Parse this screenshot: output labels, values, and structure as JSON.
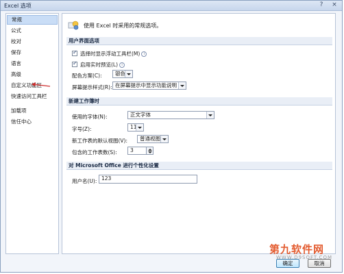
{
  "window": {
    "title": "Excel 选项",
    "help": "?",
    "close": "×"
  },
  "sidebar": {
    "items": [
      {
        "label": "常规",
        "selected": true
      },
      {
        "label": "公式"
      },
      {
        "label": "校对"
      },
      {
        "label": "保存"
      },
      {
        "label": "语言"
      },
      {
        "label": "高级"
      },
      {
        "label": "自定义功能区"
      },
      {
        "label": "快速访问工具栏"
      },
      {
        "label": "加载项"
      },
      {
        "label": "信任中心"
      }
    ],
    "annotation_arrow_color": "#cc2a2a"
  },
  "header": {
    "text": "使用 Excel 时采用的常规选项。"
  },
  "ui_options": {
    "title": "用户界面选项",
    "mini_toolbar": {
      "label": "选择时显示浮动工具栏(M)",
      "checked": true
    },
    "live_preview": {
      "label": "启用实时预览(L)",
      "checked": true
    },
    "color_scheme": {
      "label": "配色方案(C):",
      "value": "银色"
    },
    "screentip": {
      "label": "屏幕提示样式(R):",
      "value": "在屏幕提示中显示功能说明"
    }
  },
  "new_workbook": {
    "title": "新建工作簿时",
    "font": {
      "label": "使用的字体(N):",
      "value": "正文字体"
    },
    "size": {
      "label": "字号(Z):",
      "value": "11"
    },
    "default_view": {
      "label": "新工作表的默认视图(V):",
      "value": "普通视图"
    },
    "sheet_count": {
      "label": "包含的工作表数(S):",
      "value": "3"
    }
  },
  "personalize": {
    "title": "对 Microsoft Office 进行个性化设置",
    "username": {
      "label": "用户名(U):",
      "value": "123"
    }
  },
  "footer": {
    "ok": "确定",
    "cancel": "取消"
  },
  "watermark": {
    "main": "第九软件网",
    "sub": "WWW.D9SOFT.COM",
    "color": "#e35b2f"
  }
}
